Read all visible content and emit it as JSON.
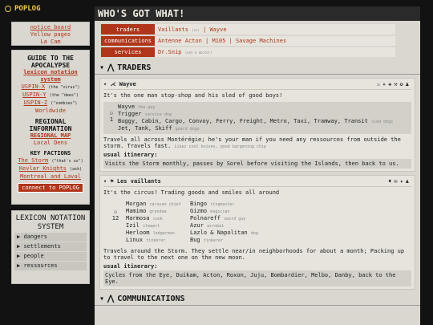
{
  "brand": "POPLOG",
  "side_top": {
    "links": [
      "notice board",
      "Yellow pages",
      "La Cam"
    ]
  },
  "guide": {
    "title": "GUIDE TO THE APOCALYPSE",
    "subtitle": "lexicon notation system",
    "items": [
      {
        "label": "USPIN-X",
        "note": "(the \"virus\")"
      },
      {
        "label": "USPIN-Y",
        "note": "(the \"dees\")"
      },
      {
        "label": "USPIN-Z",
        "note": "(\"zombies\")"
      },
      {
        "label": "Worldwide",
        "note": ""
      }
    ],
    "regional_title": "REGIONAL INFORMATION",
    "regional_map": "REGIONAL MAP",
    "local_dens": "Local Dens",
    "factions_title": "KEY FACTIONS",
    "factions": [
      {
        "label": "The Storm",
        "note": "(\"that's us\")"
      },
      {
        "label": "Kevlar Knights",
        "note": "(ask)"
      },
      {
        "label": "Montreal and Laval",
        "note": ""
      }
    ],
    "connect": "connect to POPLOG"
  },
  "lexicon": {
    "title": "LEXICON NOTATION SYSTEM",
    "items": [
      "dangers",
      "settlements",
      "people",
      "ressources"
    ]
  },
  "page": {
    "title": "WHO'S GOT WHAT!",
    "summary": [
      {
        "cat": "traders",
        "val": "Vaillants",
        "tiny": "(ss)",
        "rest": " | Wayve"
      },
      {
        "cat": "communications",
        "val": "Antenne Acton | M105 | Savage Machines",
        "tiny": "",
        "rest": ""
      },
      {
        "cat": "services",
        "val": "Dr.Snip",
        "tiny": "(not a doctor)",
        "rest": ""
      }
    ]
  },
  "traders": {
    "title": "TRADERS",
    "wayve": {
      "name": "Wayve",
      "icons": "⚔✦✚⚒✪♟",
      "desc": "It's the one man stop-shop and his sled of good boys!",
      "count": "1",
      "leader": "Wayve",
      "leader_note": "the guy",
      "dog": "Trigger",
      "dog_note": "service dog",
      "sled": "Buggy, Cabin, Cargo, Convoy, Ferry, Freight, Metro, Taxi, Tramway, Transit",
      "sled_note": "sled dogs",
      "guard": "Jet, Tank, Skiff",
      "guard_note": "guard dogs",
      "travel": "Travels all across Montérégie; he's your man if you need any ressources from outside the storm. Travels fast.",
      "travel_note": "Likes cool knives, good bargening chip",
      "itin_label": "usual itinerary:",
      "itin": "Visits the Storm monthly, passes by Sorel before visiting the Islands, then back to us."
    },
    "vaillants": {
      "name": "Les vaillants",
      "icons": "♦✉✦♟",
      "desc": "It's the circus! Trading goods and smiles all around",
      "count": "12",
      "left": [
        {
          "n": "Morgan",
          "r": "caravan chief"
        },
        {
          "n": "Mamimo",
          "r": "grandma"
        },
        {
          "n": "Marmosa",
          "r": "cook"
        },
        {
          "n": "Izil",
          "r": "stewart"
        },
        {
          "n": "Herloom",
          "r": "ledgerman"
        },
        {
          "n": "Linux",
          "r": "tinkerer"
        }
      ],
      "right": [
        {
          "n": "Bingo",
          "r": "ringmaster"
        },
        {
          "n": "Gizmo",
          "r": "magician"
        },
        {
          "n": "Polnareff",
          "r": "sword guy"
        },
        {
          "n": "Azur",
          "r": "acrobat"
        },
        {
          "n": "Lazlo & Napolitan",
          "r": "dog"
        },
        {
          "n": "Bug",
          "r": "tinkerer"
        }
      ],
      "travel": "Travels around the Storm. They settle near/in neighborhoods for about a month; Packing up to travel to the next one on the new moon.",
      "itin_label": "usual itinerary:",
      "itin": "Cycles from the Eye, Duikam, Acton, Roxon, Juju, Bombardier, Melbo, Danby, back to the Eye."
    }
  },
  "communications": {
    "title": "COMMUNICATIONS"
  },
  "colors": {
    "accent": "#b0351a",
    "brand": "#f0c84a"
  }
}
